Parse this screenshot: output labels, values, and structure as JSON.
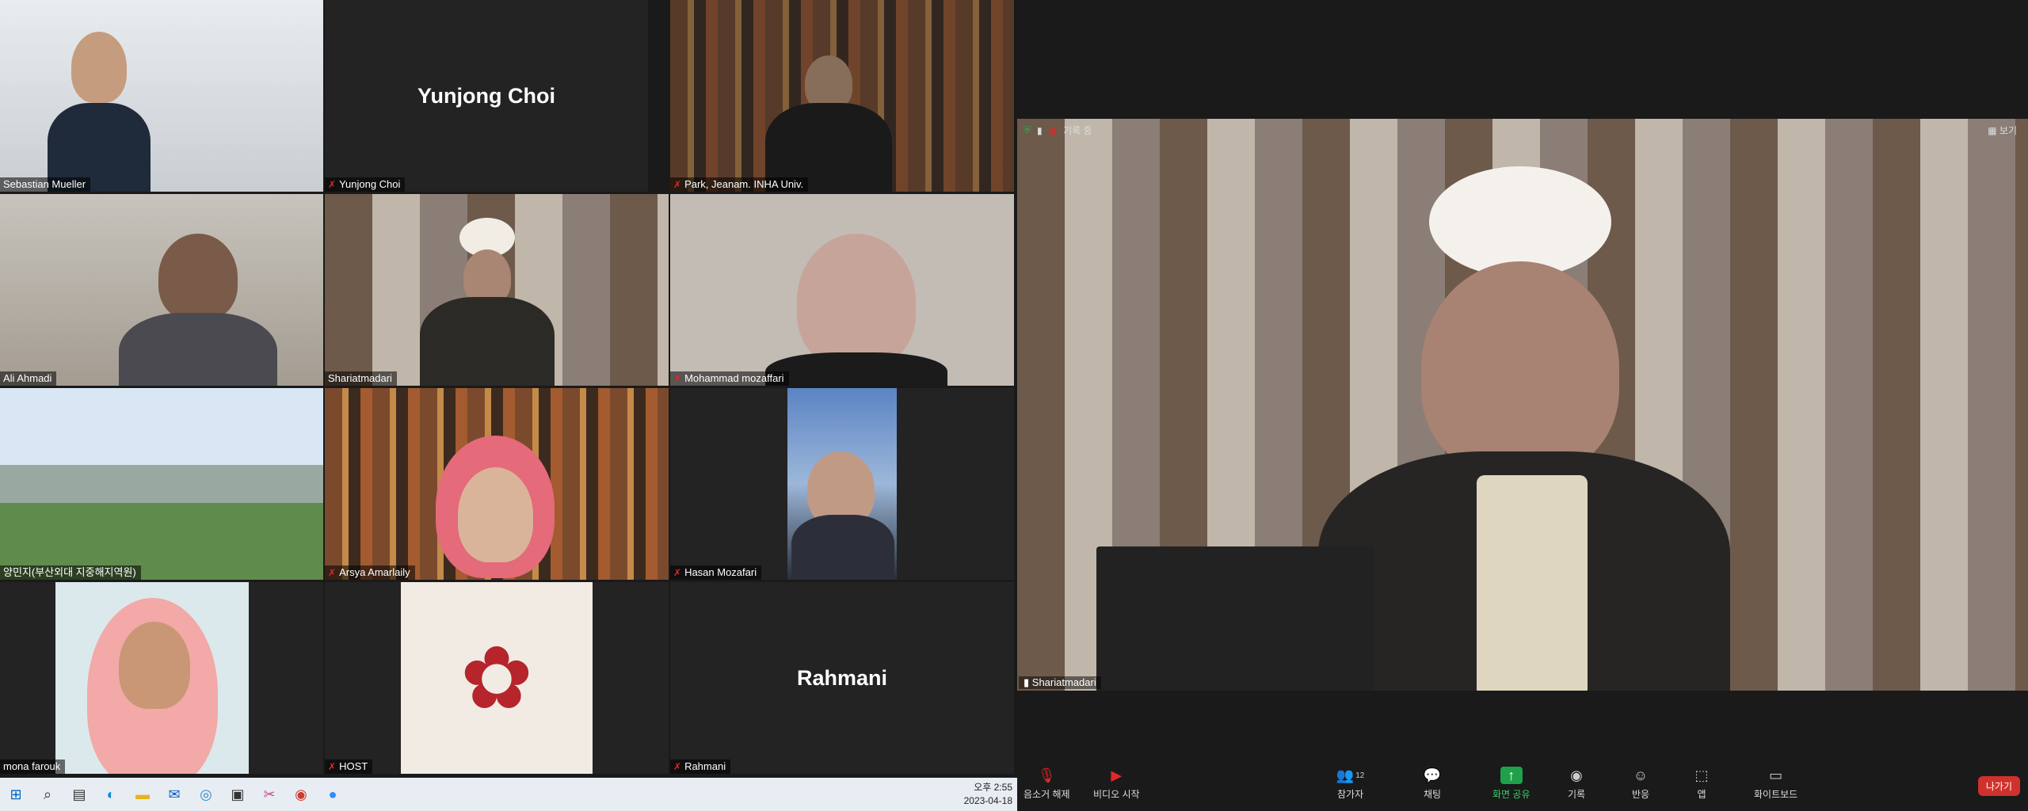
{
  "gallery": {
    "tiles": [
      {
        "name": "Sebastian Mueller",
        "muted": false
      },
      {
        "name": "Yunjong Choi",
        "muted": true,
        "big_text": "Yunjong Choi"
      },
      {
        "name": "Park, Jeanam. INHA Univ.",
        "muted": true
      },
      {
        "name": "Ali Ahmadi",
        "muted": false
      },
      {
        "name": "Shariatmadari",
        "muted": false
      },
      {
        "name": "Mohammad mozaffari",
        "muted": true
      },
      {
        "name": "양민지(부산외대 지중해지역원)",
        "muted": false
      },
      {
        "name": "Arsya Amarlaily",
        "muted": true
      },
      {
        "name": "Hasan Mozafari",
        "muted": true
      },
      {
        "name": "mona farouk",
        "muted": false
      },
      {
        "name": "HOST",
        "muted": true
      },
      {
        "name": "Rahmani",
        "muted": true,
        "big_text": "Rahmani"
      }
    ]
  },
  "speaker": {
    "name": "Shariatmadari",
    "recording_label": "기록 중",
    "view_label": "보기"
  },
  "toolbar": {
    "items": [
      {
        "label": "음소거 해제",
        "icon": "mic-off-icon"
      },
      {
        "label": "비디오 시작",
        "icon": "video-off-icon"
      },
      {
        "label": "참가자",
        "icon": "participants-icon",
        "count": "12"
      },
      {
        "label": "채팅",
        "icon": "chat-icon"
      },
      {
        "label": "화면 공유",
        "icon": "share-screen-icon"
      },
      {
        "label": "기록",
        "icon": "record-icon"
      },
      {
        "label": "반응",
        "icon": "reaction-icon"
      },
      {
        "label": "앱",
        "icon": "apps-icon"
      },
      {
        "label": "화이트보드",
        "icon": "whiteboard-icon"
      }
    ],
    "leave_label": "나가기"
  },
  "taskbar": {
    "time": "오후 2:55",
    "date": "2023-04-18"
  },
  "colors": {
    "leave": "#d0312d",
    "active_border": "#c6d83a",
    "share": "#1fa14a"
  }
}
